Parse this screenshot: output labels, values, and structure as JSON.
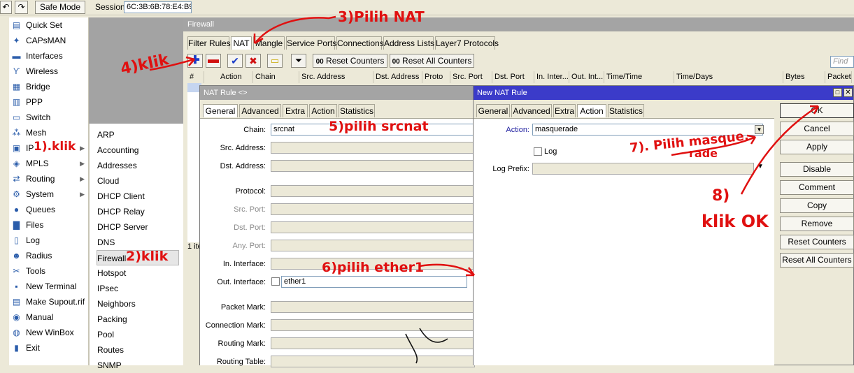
{
  "topbar": {
    "safe_mode": "Safe Mode",
    "session_label": "Session:",
    "session_value": "6C:3B:6B:78:E4:B9"
  },
  "menu": [
    {
      "label": "Quick Set",
      "icon": "quick-set-icon",
      "glyph": "▤"
    },
    {
      "label": "CAPsMAN",
      "icon": "capsman-icon",
      "glyph": "✦"
    },
    {
      "label": "Interfaces",
      "icon": "interfaces-icon",
      "glyph": "▬"
    },
    {
      "label": "Wireless",
      "icon": "wireless-icon",
      "glyph": "ϒ"
    },
    {
      "label": "Bridge",
      "icon": "bridge-icon",
      "glyph": "▦"
    },
    {
      "label": "PPP",
      "icon": "ppp-icon",
      "glyph": "▥"
    },
    {
      "label": "Switch",
      "icon": "switch-icon",
      "glyph": "▭"
    },
    {
      "label": "Mesh",
      "icon": "mesh-icon",
      "glyph": "⁂"
    },
    {
      "label": "IP",
      "icon": "ip-icon",
      "glyph": "▣"
    },
    {
      "label": "MPLS",
      "icon": "mpls-icon",
      "glyph": "◈"
    },
    {
      "label": "Routing",
      "icon": "routing-icon",
      "glyph": "⇄"
    },
    {
      "label": "System",
      "icon": "system-icon",
      "glyph": "⚙"
    },
    {
      "label": "Queues",
      "icon": "queues-icon",
      "glyph": "●"
    },
    {
      "label": "Files",
      "icon": "files-icon",
      "glyph": "▇"
    },
    {
      "label": "Log",
      "icon": "log-icon",
      "glyph": "▯"
    },
    {
      "label": "Radius",
      "icon": "radius-icon",
      "glyph": "☻"
    },
    {
      "label": "Tools",
      "icon": "tools-icon",
      "glyph": "✂"
    },
    {
      "label": "New Terminal",
      "icon": "terminal-icon",
      "glyph": "▪"
    },
    {
      "label": "Make Supout.rif",
      "icon": "supout-icon",
      "glyph": "▤"
    },
    {
      "label": "Manual",
      "icon": "manual-icon",
      "glyph": "◉"
    },
    {
      "label": "New WinBox",
      "icon": "winbox-icon",
      "glyph": "◍"
    },
    {
      "label": "Exit",
      "icon": "exit-icon",
      "glyph": "▮"
    }
  ],
  "submenu": [
    "ARP",
    "Accounting",
    "Addresses",
    "Cloud",
    "DHCP Client",
    "DHCP Relay",
    "DHCP Server",
    "DNS",
    "Firewall",
    "Hotspot",
    "IPsec",
    "Neighbors",
    "Packing",
    "Pool",
    "Routes",
    "SNMP"
  ],
  "firewall": {
    "title": "Firewall",
    "tabs": [
      "Filter Rules",
      "NAT",
      "Mangle",
      "Service Ports",
      "Connections",
      "Address Lists",
      "Layer7 Protocols"
    ],
    "reset_counters": "Reset Counters",
    "reset_all_counters": "Reset All Counters",
    "find_placeholder": "Find",
    "columns": [
      "#",
      "Action",
      "Chain",
      "Src. Address",
      "Dst. Address",
      "Proto",
      "Src. Port",
      "Dst. Port",
      "In. Inter...",
      "Out. Int...",
      "Time/Time",
      "Time/Days",
      "Bytes",
      "Packets"
    ],
    "status": "1 ite"
  },
  "nat_rule": {
    "title": "NAT Rule <>",
    "tabs": [
      "General",
      "Advanced",
      "Extra",
      "Action",
      "Statistics"
    ],
    "fields": {
      "chain": {
        "label": "Chain:",
        "value": "srcnat"
      },
      "src_address": "Src. Address:",
      "dst_address": "Dst. Address:",
      "protocol": "Protocol:",
      "src_port": "Src. Port:",
      "dst_port": "Dst. Port:",
      "any_port": "Any. Port:",
      "in_interface": "In. Interface:",
      "out_interface": {
        "label": "Out. Interface:",
        "value": "ether1"
      },
      "packet_mark": "Packet Mark:",
      "connection_mark": "Connection Mark:",
      "routing_mark": "Routing Mark:",
      "routing_table": "Routing Table:"
    }
  },
  "new_nat_rule": {
    "title": "New NAT Rule",
    "tabs": [
      "General",
      "Advanced",
      "Extra",
      "Action",
      "Statistics"
    ],
    "action_label": "Action:",
    "action_value": "masquerade",
    "log_label": "Log",
    "log_prefix_label": "Log Prefix:",
    "buttons": [
      "OK",
      "Cancel",
      "Apply",
      "Disable",
      "Comment",
      "Copy",
      "Remove",
      "Reset Counters",
      "Reset All Counters"
    ]
  },
  "annotations": {
    "a1": "1).klik",
    "a2": "2)klik",
    "a3": "3)Pilih NAT",
    "a4": "4)klik",
    "a5": "5)pilih srcnat",
    "a6": "6)pilih ether1",
    "a7a": "7). Pilih masque.",
    "a7b": "rade",
    "a8": "8)",
    "a8b": "klik OK"
  },
  "colors": {
    "title_active": "#3b3bc9",
    "title_inactive": "#a4a4a4",
    "annotation": "#e01010",
    "action_label": "#2020a0"
  }
}
